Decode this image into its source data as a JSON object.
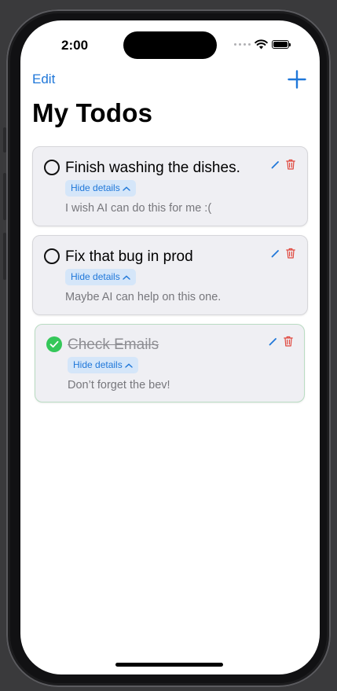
{
  "status_bar": {
    "time": "2:00"
  },
  "nav": {
    "edit_label": "Edit",
    "add_icon": "plus-icon"
  },
  "page": {
    "title": "My Todos"
  },
  "todos": [
    {
      "title": "Finish washing the dishes.",
      "toggle_label": "Hide details",
      "details": "I wish AI can do this for me :(",
      "completed": false
    },
    {
      "title": "Fix that bug in prod",
      "toggle_label": "Hide details",
      "details": "Maybe AI can help on this one.",
      "completed": false
    },
    {
      "title": "Check Emails",
      "toggle_label": "Hide details",
      "details": "Don’t forget the bev!",
      "completed": true
    }
  ],
  "colors": {
    "accent": "#1f77d9",
    "delete": "#e0473d",
    "complete": "#34c759",
    "card_bg": "#efeff3"
  },
  "icons": {
    "edit": "pencil-icon",
    "delete": "trash-icon",
    "collapse": "chevron-up-icon",
    "check": "checkmark-icon"
  }
}
